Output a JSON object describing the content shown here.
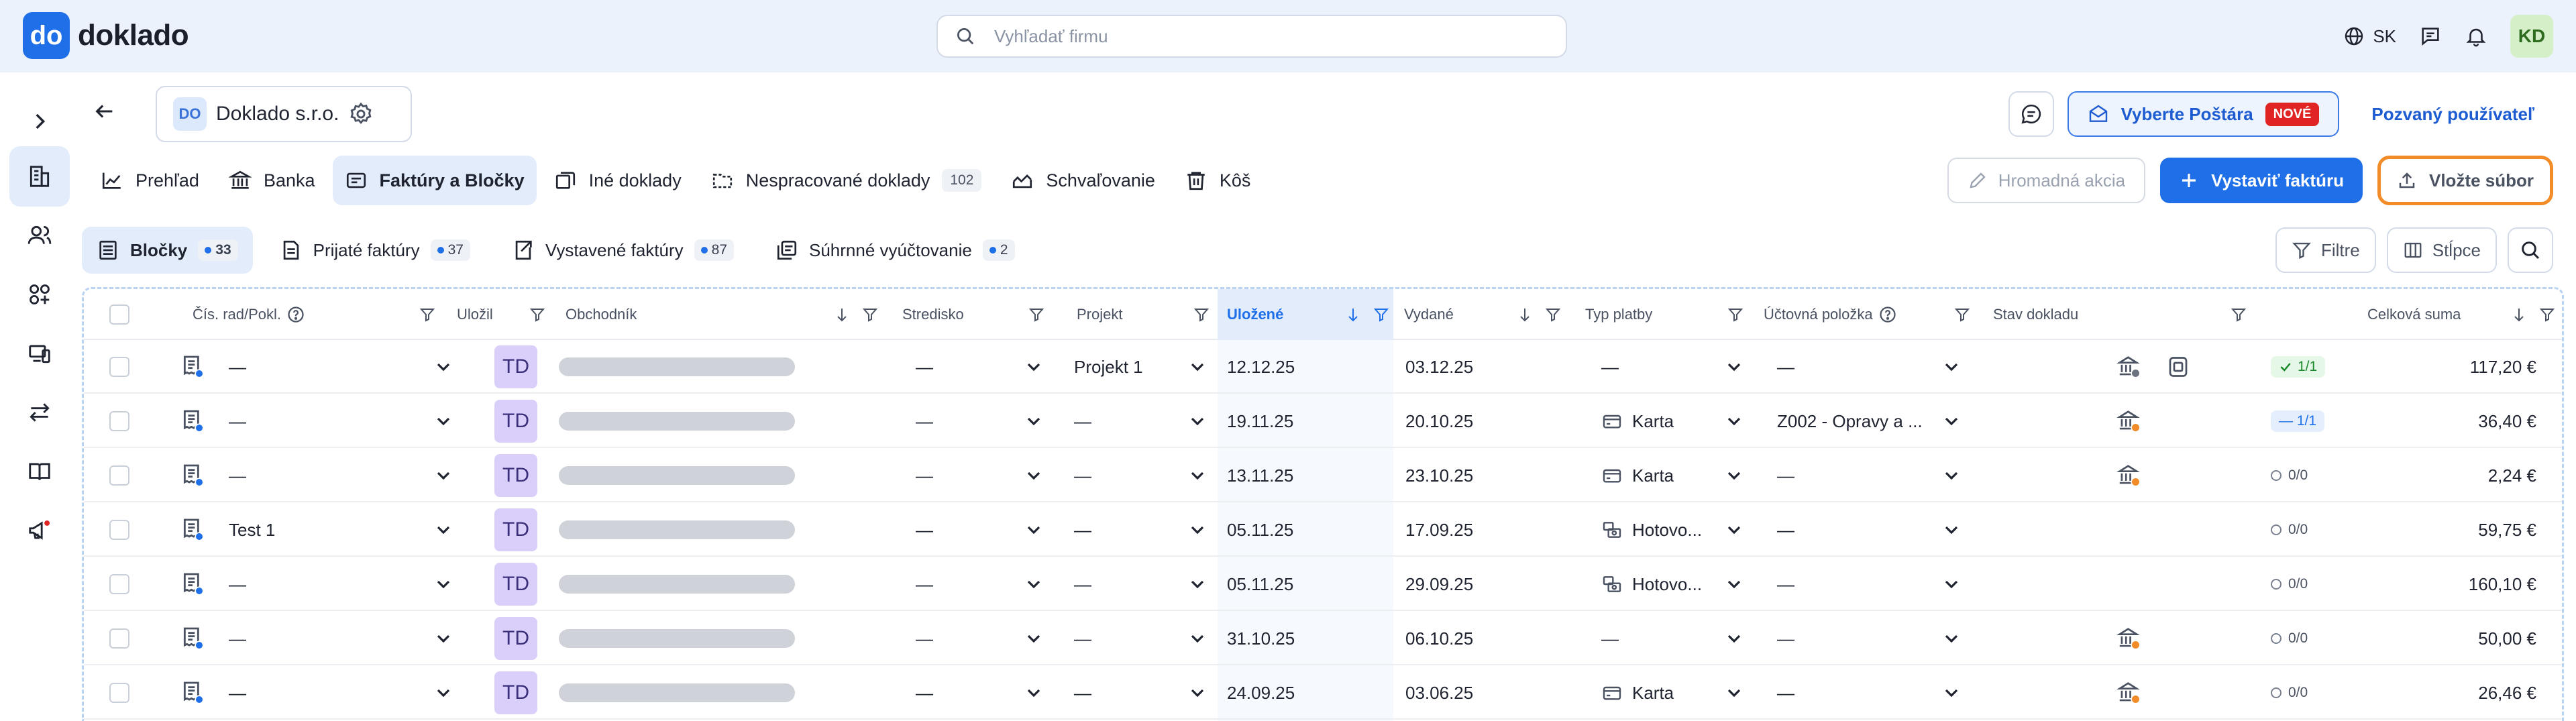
{
  "header": {
    "logo_mark": "do",
    "logo_text": "doklado",
    "search_placeholder": "Vyhľadať firmu",
    "language": "SK",
    "user_initials": "KD"
  },
  "company": {
    "badge": "DO",
    "name": "Doklado s.r.o."
  },
  "top_actions": {
    "postar_label": "Vyberte Poštára",
    "postar_badge": "NOVÉ",
    "invited_label": "Pozvaný používateľ"
  },
  "nav": {
    "items": [
      {
        "label": "Prehľad"
      },
      {
        "label": "Banka"
      },
      {
        "label": "Faktúry a Bločky"
      },
      {
        "label": "Iné doklady"
      },
      {
        "label": "Nespracované doklady",
        "count": "102"
      },
      {
        "label": "Schvaľovanie"
      },
      {
        "label": "Kôš"
      }
    ],
    "mass_action": "Hromadná akcia",
    "issue_invoice": "Vystaviť faktúru",
    "upload": "Vložte súbor"
  },
  "subtabs": {
    "items": [
      {
        "label": "Bločky",
        "count": "33"
      },
      {
        "label": "Prijaté faktúry",
        "count": "37"
      },
      {
        "label": "Vystavené faktúry",
        "count": "87"
      },
      {
        "label": "Súhrnné vyúčtovanie",
        "count": "2"
      }
    ],
    "filters": "Filtre",
    "columns": "Stĺpce"
  },
  "table": {
    "headers": {
      "number": "Čís. rad/Pokl.",
      "saved_by": "Uložil",
      "merchant": "Obchodník",
      "center": "Stredisko",
      "project": "Projekt",
      "saved": "Uložené",
      "issued": "Vydané",
      "payment": "Typ platby",
      "account_item": "Účtovná položka",
      "doc_state": "Stav dokladu",
      "total": "Celková suma"
    },
    "rows": [
      {
        "number": "—",
        "user": "TD",
        "center": "—",
        "project": "Projekt 1",
        "saved": "12.12.25",
        "issued": "03.12.25",
        "payment": "—",
        "account": "—",
        "state": "1/1",
        "state_type": "ok",
        "total": "117,20 €"
      },
      {
        "number": "—",
        "user": "TD",
        "center": "—",
        "project": "—",
        "saved": "19.11.25",
        "issued": "20.10.25",
        "payment": "Karta",
        "account": "Z002 - Opravy a ...",
        "state": "1/1",
        "state_type": "part",
        "total": "36,40 €"
      },
      {
        "number": "—",
        "user": "TD",
        "center": "—",
        "project": "—",
        "saved": "13.11.25",
        "issued": "23.10.25",
        "payment": "Karta",
        "account": "—",
        "state": "0/0",
        "state_type": "none",
        "total": "2,24 €"
      },
      {
        "number": "Test 1",
        "user": "TD",
        "center": "—",
        "project": "—",
        "saved": "05.11.25",
        "issued": "17.09.25",
        "payment": "Hotovo...",
        "account": "—",
        "state": "0/0",
        "state_type": "none",
        "total": "59,75 €"
      },
      {
        "number": "—",
        "user": "TD",
        "center": "—",
        "project": "—",
        "saved": "05.11.25",
        "issued": "29.09.25",
        "payment": "Hotovo...",
        "account": "—",
        "state": "0/0",
        "state_type": "none",
        "total": "160,10 €"
      },
      {
        "number": "—",
        "user": "TD",
        "center": "—",
        "project": "—",
        "saved": "31.10.25",
        "issued": "06.10.25",
        "payment": "—",
        "account": "—",
        "state": "0/0",
        "state_type": "none",
        "total": "50,00 €"
      },
      {
        "number": "—",
        "user": "TD",
        "center": "—",
        "project": "—",
        "saved": "24.09.25",
        "issued": "03.06.25",
        "payment": "Karta",
        "account": "—",
        "state": "0/0",
        "state_type": "none",
        "total": "26,46 €"
      }
    ]
  }
}
